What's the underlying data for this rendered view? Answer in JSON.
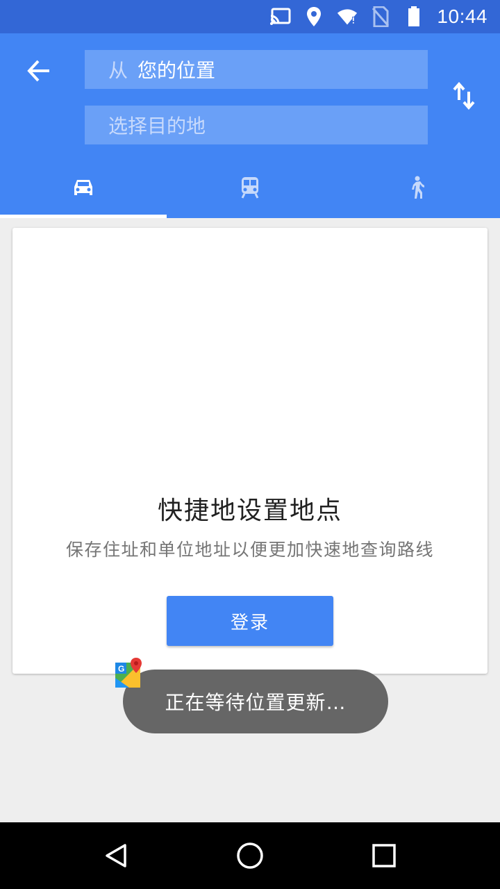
{
  "status_bar": {
    "time": "10:44",
    "icons": [
      "cast-icon",
      "location-pin-icon",
      "wifi-icon",
      "no-sim-icon",
      "battery-icon"
    ]
  },
  "header": {
    "back_icon": "arrow-back-icon",
    "from_prefix": "从",
    "from_value": "您的位置",
    "to_placeholder": "选择目的地",
    "swap_icon": "swap-vertical-icon",
    "tabs": [
      {
        "id": "drive",
        "icon": "car-icon",
        "active": true
      },
      {
        "id": "transit",
        "icon": "train-icon",
        "active": false
      },
      {
        "id": "walk",
        "icon": "walk-icon",
        "active": false
      }
    ]
  },
  "card": {
    "title": "快捷地设置地点",
    "subtitle": "保存住址和单位地址以便更加快速地查询路线",
    "login_label": "登录"
  },
  "toast": {
    "message": "正在等待位置更新…",
    "app_icon": "google-maps-icon"
  },
  "colors": {
    "status_bar": "#3367d6",
    "app_bar": "#4285f4",
    "accent": "#4285f4",
    "toast_bg": "#666666",
    "background": "#eeeeee"
  },
  "nav_bar": {
    "icons": [
      "back-triangle-icon",
      "home-circle-icon",
      "recents-square-icon"
    ]
  }
}
